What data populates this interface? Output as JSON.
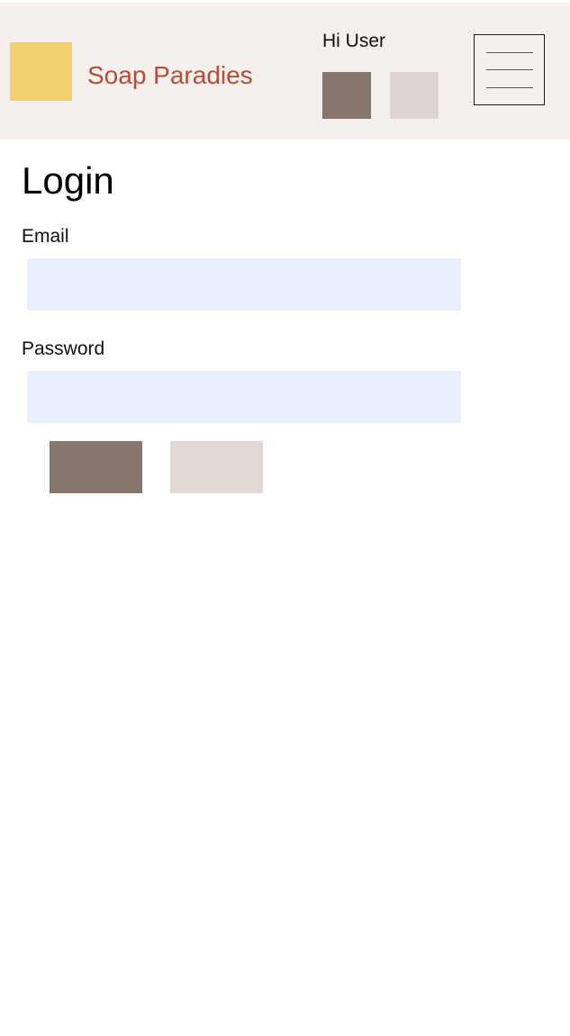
{
  "header": {
    "brand_name": "Soap Paradies",
    "greeting": "Hi User",
    "primary_button_label": "",
    "secondary_button_label": ""
  },
  "login": {
    "title": "Login",
    "email_label": "Email",
    "email_value": "",
    "password_label": "Password",
    "password_value": "",
    "primary_button_label": "",
    "secondary_button_label": ""
  },
  "colors": {
    "header_bg": "#f5efed",
    "logo": "#f3d06f",
    "brand_text": "#b34e38",
    "primary_button": "#86766e",
    "header_secondary_button": "#ddd5d1",
    "form_secondary_button": "#e2d9d4",
    "input_bg": "#e8effd"
  },
  "icons": {
    "menu": "hamburger-menu-icon"
  }
}
